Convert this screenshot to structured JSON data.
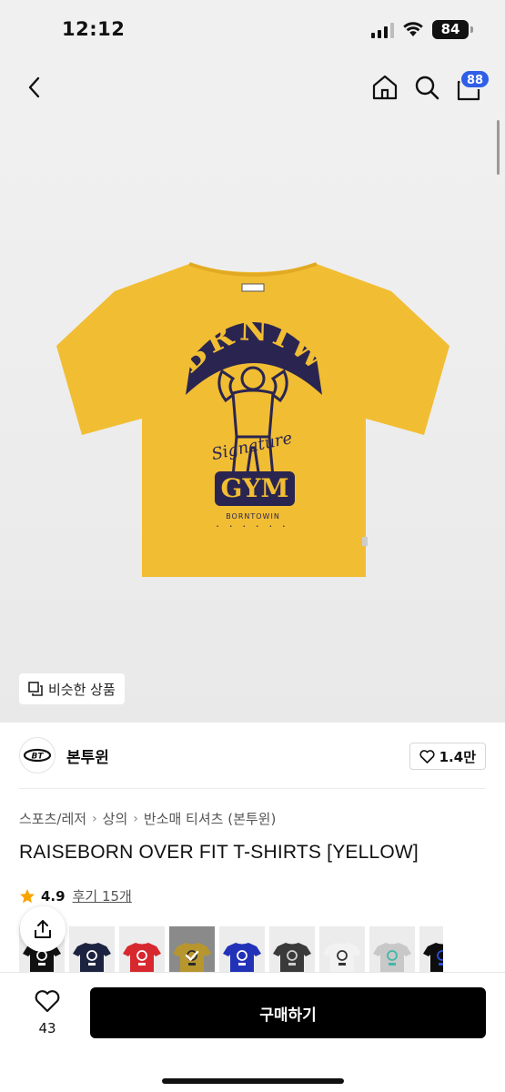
{
  "status": {
    "time": "12:12",
    "battery": "84"
  },
  "nav": {
    "cart_count": "88"
  },
  "hero": {
    "tee_color": "#f1bd33",
    "print": {
      "top_text": "BRNIW",
      "bottom_text": "GYM",
      "brand_line": "BORNTOWIN"
    },
    "similar_label": "비슷한 상품"
  },
  "brand": {
    "name": "본투윈",
    "like_count": "1.4만"
  },
  "breadcrumb": [
    "스포츠/레저",
    "상의",
    "반소매 티셔츠 (본투윈)"
  ],
  "product": {
    "title": "RAISEBORN OVER FIT T-SHIRTS [YELLOW]",
    "rating": "4.9",
    "review_label": "후기 15개"
  },
  "swatches": [
    {
      "color": "#111111",
      "print": "#ffffff",
      "selected": false
    },
    {
      "color": "#1c2340",
      "print": "#ffffff",
      "selected": false
    },
    {
      "color": "#d7282f",
      "print": "#ffffff",
      "selected": false
    },
    {
      "color": "#b8962e",
      "print": "#2a2a2a",
      "selected": true
    },
    {
      "color": "#2232b8",
      "print": "#ffffff",
      "selected": false
    },
    {
      "color": "#3a3a3a",
      "print": "#cfcfcf",
      "selected": false
    },
    {
      "color": "#f2f2f2",
      "print": "#333333",
      "selected": false
    },
    {
      "color": "#c8c8c8",
      "print": "#3fb8a8",
      "selected": false
    },
    {
      "color": "#0d0d0d",
      "print": "#2f4fd6",
      "selected": false
    }
  ],
  "bottom": {
    "wish_count": "43",
    "buy_label": "구매하기"
  },
  "colors": {
    "accent": "#2f5fe6",
    "star": "#f7a400",
    "button": "#000000"
  }
}
